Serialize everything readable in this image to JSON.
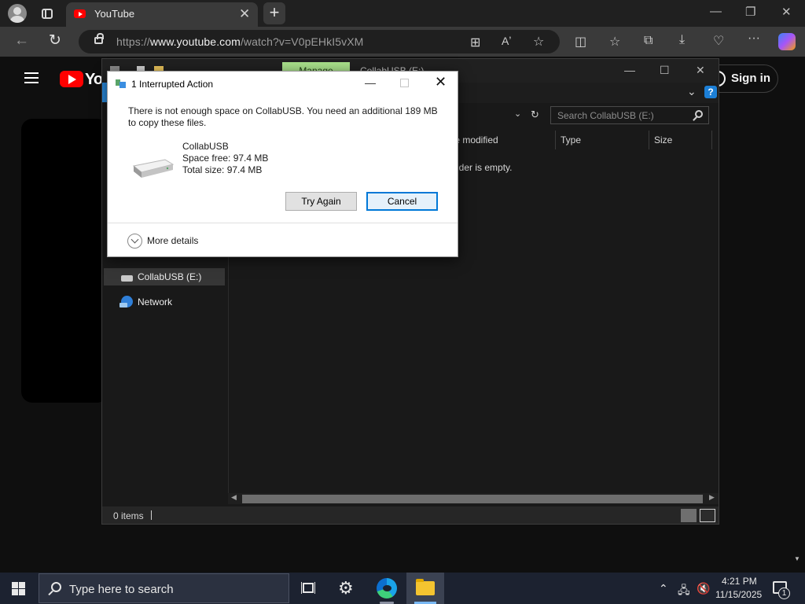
{
  "browser": {
    "tab_title": "YouTube",
    "url_prefix": "https://",
    "url_host": "www.youtube.com",
    "url_path": "/watch?v=V0pEHkI5vXM",
    "colors": {
      "chrome": "#202020",
      "toolbar": "#3a3a3a"
    }
  },
  "youtube": {
    "logo_text": "You",
    "sign_in_label": "Sign in",
    "brand_color": "#ff0000"
  },
  "explorer": {
    "manage_label": "Manage",
    "title": "CollabUSB (E:)",
    "search_placeholder": "Search CollabUSB (E:)",
    "columns": [
      "te modified",
      "Type",
      "Size"
    ],
    "empty_message": "lder is empty.",
    "nav_items": [
      {
        "label": "CollabUSB (E:)",
        "icon": "usb-drive-icon",
        "selected": true
      },
      {
        "label": "Network",
        "icon": "network-icon",
        "selected": false
      }
    ],
    "status_text": "0 items",
    "help_label": "?"
  },
  "dialog": {
    "title": "1 Interrupted Action",
    "message_line1": "There is not enough space on CollabUSB. You need an additional 189 MB",
    "message_line2": "to copy these files.",
    "drive_name": "CollabUSB",
    "space_free": "Space free: 97.4 MB",
    "total_size": "Total size: 97.4 MB",
    "try_again_label": "Try Again",
    "cancel_label": "Cancel",
    "more_details_label": "More details"
  },
  "taskbar": {
    "search_placeholder": "Type here to search",
    "time": "4:21 PM",
    "date": "11/15/2025",
    "notification_count": "1",
    "pinned": [
      "task-view-icon",
      "settings-icon",
      "edge-icon",
      "file-explorer-icon"
    ]
  }
}
